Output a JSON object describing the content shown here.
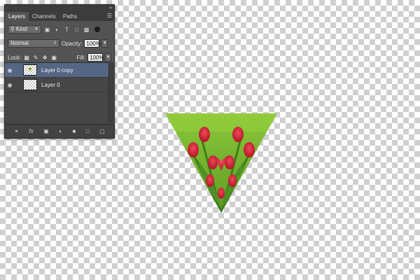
{
  "panel": {
    "collapse_icon": "double-chevron-icon",
    "tabs": [
      {
        "label": "Layers",
        "active": true
      },
      {
        "label": "Channels",
        "active": false
      },
      {
        "label": "Paths",
        "active": false
      }
    ],
    "filter": {
      "kind_label": "Kind"
    },
    "blend_mode": "Normal",
    "opacity_label": "Opacity:",
    "opacity_value": "100%",
    "lock_label": "Lock:",
    "fill_label": "Fill:",
    "fill_value": "100%",
    "layers": [
      {
        "name": "Layer 0 copy",
        "selected": true
      },
      {
        "name": "Layer 0",
        "selected": false
      }
    ],
    "footer_icons": [
      "link-icon",
      "fx-icon",
      "mask-icon",
      "adjustment-icon",
      "folder-icon",
      "new-layer-icon",
      "trash-icon"
    ]
  },
  "colors": {
    "panel_bg": "#535353",
    "selection": "#556684",
    "grass": "#7cbb2f",
    "tulip": "#d8243b"
  }
}
